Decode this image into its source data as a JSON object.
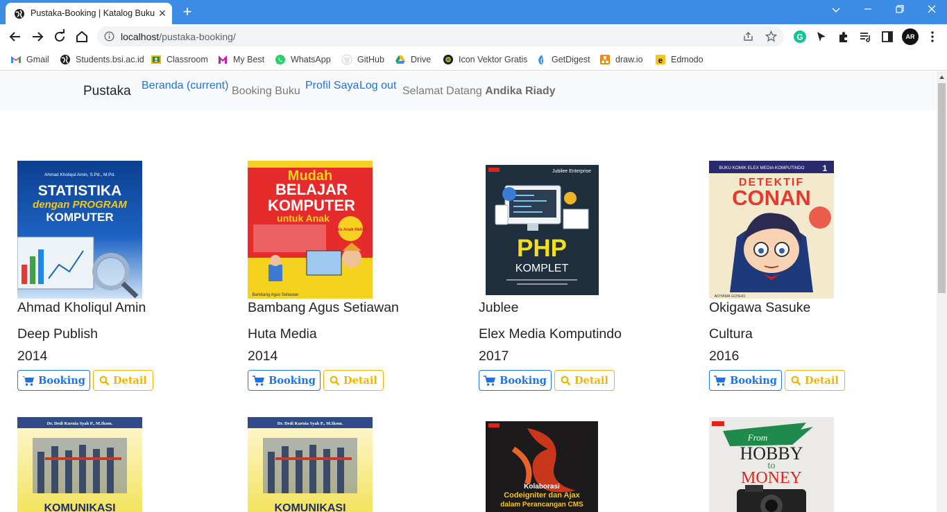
{
  "browser": {
    "tab": {
      "title": "Pustaka-Booking | Katalog Buku"
    },
    "address": {
      "host": "localhost",
      "path": "/pustaka-booking/"
    },
    "profile_initials": "AR",
    "bookmarks": [
      {
        "label": "Gmail",
        "icon": "gmail-icon",
        "color": "#ea4335"
      },
      {
        "label": "Students.bsi.ac.id",
        "icon": "globe-icon",
        "color": "#3c4043"
      },
      {
        "label": "Classroom",
        "icon": "classroom-icon",
        "color": "#f6b400"
      },
      {
        "label": "My Best",
        "icon": "mybest-icon",
        "color": "#c51ac2"
      },
      {
        "label": "WhatsApp",
        "icon": "whatsapp-icon",
        "color": "#25d366"
      },
      {
        "label": "GitHub",
        "icon": "github-icon",
        "color": "#999"
      },
      {
        "label": "Drive",
        "icon": "drive-icon",
        "color": "#1da462"
      },
      {
        "label": "Icon Vektor Gratis",
        "icon": "freepik-icon",
        "color": "#1c1c1c"
      },
      {
        "label": "GetDigest",
        "icon": "getdigest-icon",
        "color": "#2d8cff"
      },
      {
        "label": "draw.io",
        "icon": "drawio-icon",
        "color": "#f08705"
      },
      {
        "label": "Edmodo",
        "icon": "edmodo-icon",
        "color": "#f9c814"
      }
    ]
  },
  "navbar": {
    "brand": "Pustaka",
    "links": {
      "beranda": "Beranda (current)",
      "booking": "Booking Buku",
      "profil": "Profil Saya",
      "logout": "Log out"
    },
    "greeting_prefix": "Selamat Datang",
    "user_name": "Andika Riady"
  },
  "buttons": {
    "booking": "Booking",
    "detail": "Detail"
  },
  "books": [
    {
      "author": "Ahmad Kholiqul Amin",
      "publisher": "Deep Publish",
      "year": "2014",
      "cover": {
        "lines": [
          "Ahmad Kholiqul Amin, S.Pd., M.Pd.",
          "STATISTIKA",
          "dengan PROGRAM",
          "KOMPUTER"
        ]
      }
    },
    {
      "author": "Bambang Agus Setiawan",
      "publisher": "Huta Media",
      "year": "2014",
      "cover": {
        "lines": [
          "Mudah",
          "BELAJAR",
          "KOMPUTER",
          "untuk Anak",
          "Aku Anak Hebat",
          "Bambang Agus Setiawan"
        ]
      }
    },
    {
      "author": "Jublee",
      "publisher": "Elex Media Komputindo",
      "year": "2017",
      "cover": {
        "lines": [
          "Jubilee Enterprise",
          "PHP",
          "KOMPLET"
        ]
      }
    },
    {
      "author": "Okigawa Sasuke",
      "publisher": "Cultura",
      "year": "2016",
      "cover": {
        "lines": [
          "BUKU KOMIK ELEX MEDIA KOMPUTINDO",
          "1",
          "DETEKTIF",
          "CONAN",
          "AOYAMA GOSHO"
        ]
      }
    }
  ],
  "second_row_covers": [
    {
      "lines": [
        "Dr. Dedi Kurnia Syah P., M.Ikom.",
        "KOMUNIKASI"
      ]
    },
    {
      "lines": [
        "Dr. Dedi Kurnia Syah P., M.Ikom.",
        "KOMUNIKASI"
      ]
    },
    {
      "lines": [
        "Kolaborasi",
        "Codeigniter dan Ajax",
        "dalam Perancangan CMS"
      ]
    },
    {
      "lines": [
        "From",
        "HOBBY",
        "to",
        "MONEY"
      ]
    }
  ]
}
